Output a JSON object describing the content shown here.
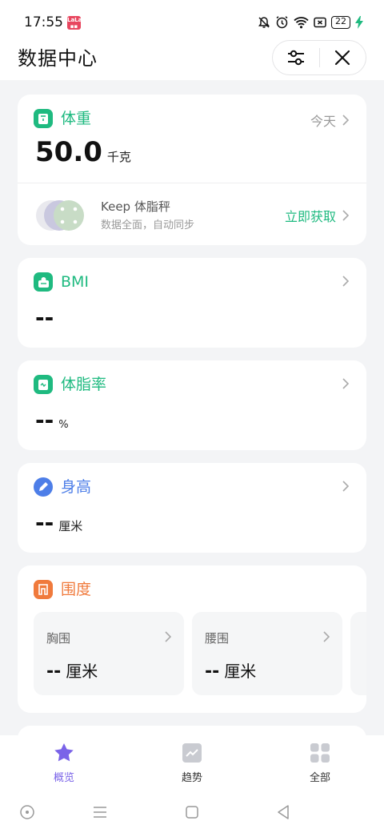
{
  "status": {
    "time": "17:55",
    "app_badge": "LaLa",
    "battery": "22"
  },
  "header": {
    "title": "数据中心"
  },
  "colors": {
    "green": "#1fba80",
    "blue": "#4d7ee8",
    "orange": "#f07a3c",
    "purple": "#7a63e8"
  },
  "weight": {
    "title": "体重",
    "date_label": "今天",
    "value": "50.0",
    "unit": "千克",
    "keep": {
      "title": "Keep 体脂秤",
      "subtitle": "数据全面，自动同步",
      "cta": "立即获取"
    }
  },
  "bmi": {
    "title": "BMI",
    "value": "--"
  },
  "body_fat": {
    "title": "体脂率",
    "value": "--",
    "unit": "%"
  },
  "height": {
    "title": "身高",
    "value": "--",
    "unit": "厘米"
  },
  "girth": {
    "title": "围度",
    "items": [
      {
        "label": "胸围",
        "value": "--",
        "unit": "厘米"
      },
      {
        "label": "腰围",
        "value": "--",
        "unit": "厘米"
      }
    ]
  },
  "tabs": [
    {
      "label": "概览",
      "icon": "star-icon",
      "active": true
    },
    {
      "label": "趋势",
      "icon": "trend-icon",
      "active": false
    },
    {
      "label": "全部",
      "icon": "grid-icon",
      "active": false
    }
  ]
}
